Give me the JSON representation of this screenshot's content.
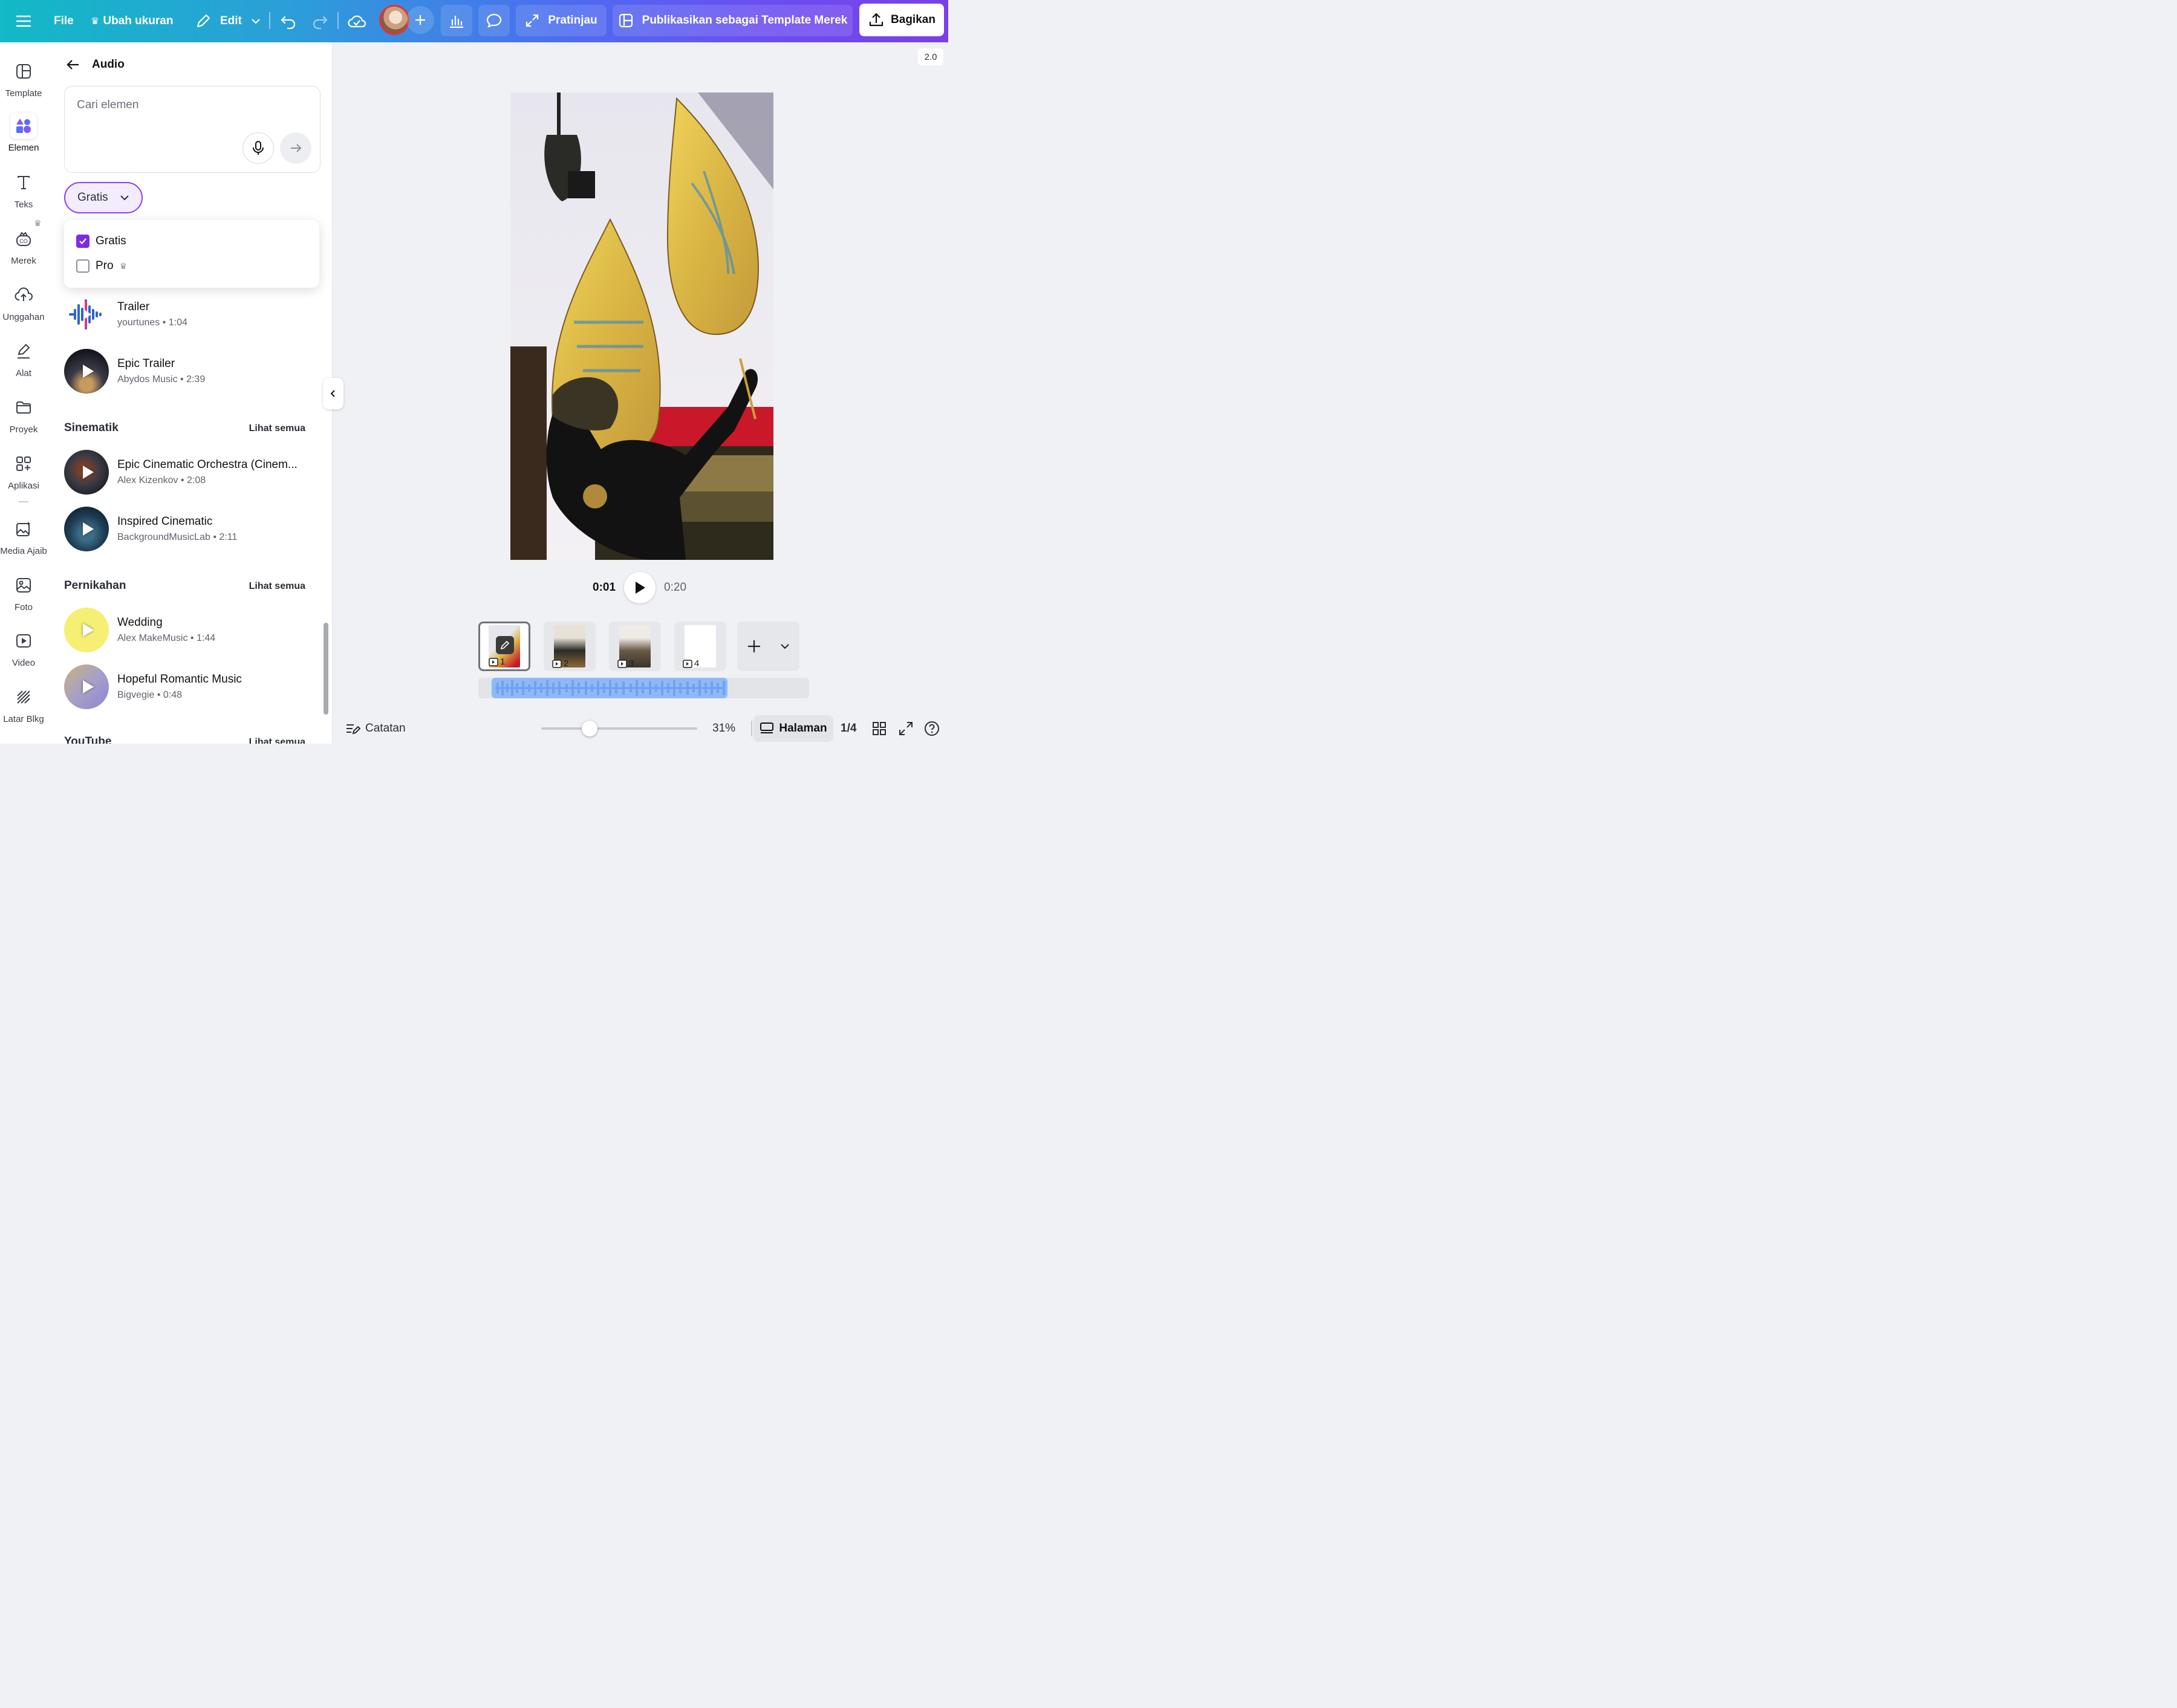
{
  "topbar": {
    "file_label": "File",
    "resize_label": "Ubah ukuran",
    "edit_label": "Edit",
    "preview_label": "Pratinjau",
    "publish_label": "Publikasikan sebagai Template Merek",
    "share_label": "Bagikan"
  },
  "rail": {
    "items": [
      {
        "label": "Template",
        "icon": "template-icon"
      },
      {
        "label": "Elemen",
        "icon": "elements-icon"
      },
      {
        "label": "Teks",
        "icon": "text-icon"
      },
      {
        "label": "Merek",
        "icon": "brand-icon"
      },
      {
        "label": "Unggahan",
        "icon": "upload-icon"
      },
      {
        "label": "Alat",
        "icon": "draw-icon"
      },
      {
        "label": "Proyek",
        "icon": "folder-icon"
      },
      {
        "label": "Aplikasi",
        "icon": "apps-icon"
      },
      {
        "label": "Media Ajaib",
        "icon": "magic-media-icon"
      },
      {
        "label": "Foto",
        "icon": "photo-icon"
      },
      {
        "label": "Video",
        "icon": "video-icon"
      },
      {
        "label": "Latar Blkg",
        "icon": "background-icon"
      }
    ]
  },
  "panel": {
    "title": "Audio",
    "search_placeholder": "Cari elemen",
    "filter_label": "Gratis",
    "filter_options": [
      {
        "label": "Gratis",
        "checked": true
      },
      {
        "label": "Pro",
        "checked": false
      }
    ],
    "tracks_top": [
      {
        "title": "Trailer",
        "sub": "yourtunes • 1:04"
      },
      {
        "title": "Epic Trailer",
        "sub": "Abydos Music • 2:39"
      }
    ],
    "sections": [
      {
        "title": "Sinematik",
        "see_all": "Lihat semua",
        "tracks": [
          {
            "title": "Epic Cinematic Orchestra (Cinem...",
            "sub": "Alex Kizenkov • 2:08"
          },
          {
            "title": "Inspired Cinematic",
            "sub": "BackgroundMusicLab • 2:11"
          }
        ]
      },
      {
        "title": "Pernikahan",
        "see_all": "Lihat semua",
        "tracks": [
          {
            "title": "Wedding",
            "sub": "Alex MakeMusic • 1:44"
          },
          {
            "title": "Hopeful Romantic Music",
            "sub": "Bigvegie • 0:48"
          }
        ]
      },
      {
        "title": "YouTube",
        "see_all": "Lihat semua"
      }
    ]
  },
  "canvas": {
    "zoom_badge": "2.0"
  },
  "player": {
    "current": "0:01",
    "total": "0:20"
  },
  "pages": [
    "1",
    "2",
    "3",
    "4"
  ],
  "bottom": {
    "notes_label": "Catatan",
    "zoom": "31%",
    "zoom_level": 0.31,
    "pages_label": "Halaman",
    "page_counter": "1/4"
  },
  "colors": {
    "accent": "#8b3dff",
    "checkbox": "#7d2ae8"
  }
}
